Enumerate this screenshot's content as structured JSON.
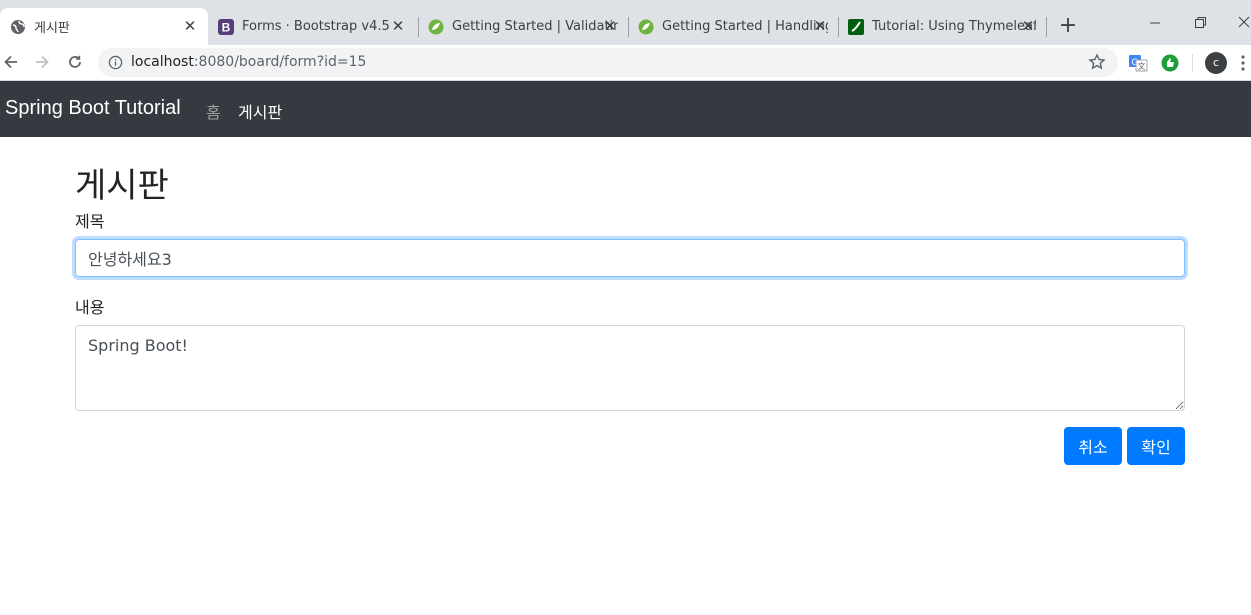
{
  "browser": {
    "tabs": [
      {
        "title": "게시판",
        "favicon": "globe-icon",
        "active": true
      },
      {
        "title": "Forms · Bootstrap v4.5",
        "favicon": "bootstrap-icon",
        "active": false
      },
      {
        "title": "Getting Started | Validating",
        "favicon": "spring-leaf-icon",
        "active": false
      },
      {
        "title": "Getting Started | Handling",
        "favicon": "spring-leaf-icon",
        "active": false
      },
      {
        "title": "Tutorial: Using Thymeleaf",
        "favicon": "thymeleaf-icon",
        "active": false
      }
    ],
    "address": {
      "host": "localhost",
      "path": ":8080/board/form?id=15"
    },
    "profile_initial": "c",
    "bootstrap_letter": "B",
    "colors": {
      "bootstrap": "#563d7c",
      "spring": "#6db33f",
      "thymeleaf": "#005f0f"
    }
  },
  "navbar": {
    "brand": "Spring Boot Tutorial",
    "items": [
      {
        "label": "홈",
        "active": false
      },
      {
        "label": "게시판",
        "active": true
      }
    ],
    "background": "#343a40"
  },
  "form": {
    "heading": "게시판",
    "title_label": "제목",
    "title_value": "안녕하세요3",
    "content_label": "내용",
    "content_value": "Spring Boot!",
    "cancel_label": "취소",
    "submit_label": "확인",
    "button_color": "#007bff"
  }
}
